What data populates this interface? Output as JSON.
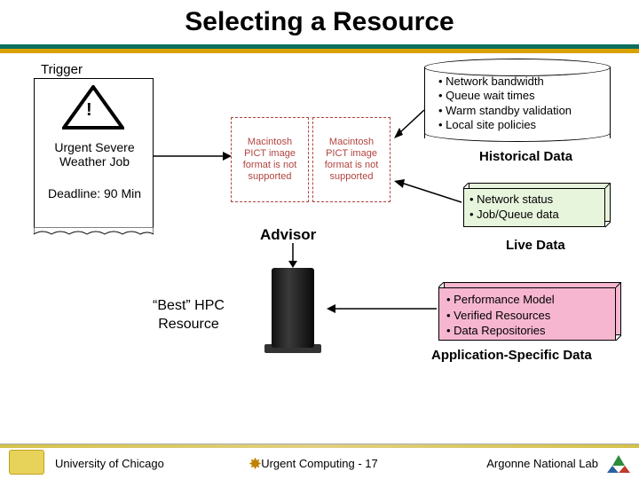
{
  "title": "Selecting a Resource",
  "trigger": {
    "label": "Trigger",
    "warn": "!",
    "line1": "Urgent Severe Weather Job",
    "line2": "Deadline: 90 Min"
  },
  "historical": {
    "items": [
      "Network bandwidth",
      "Queue wait times",
      "Warm standby validation",
      "Local site policies"
    ],
    "label": "Historical Data"
  },
  "live": {
    "items": [
      "Network status",
      "Job/Queue data"
    ],
    "label": "Live Data"
  },
  "appspec": {
    "items": [
      "Performance Model",
      "Verified Resources",
      "Data Repositories"
    ],
    "label": "Application-Specific Data"
  },
  "pict_placeholder": "Macintosh PICT image format is not supported",
  "advisor": "Advisor",
  "best": "“Best” HPC Resource",
  "footer": {
    "left": "University of Chicago",
    "center_prefix": "Urgent Computing -",
    "page": "17",
    "right": "Argonne National Lab"
  }
}
